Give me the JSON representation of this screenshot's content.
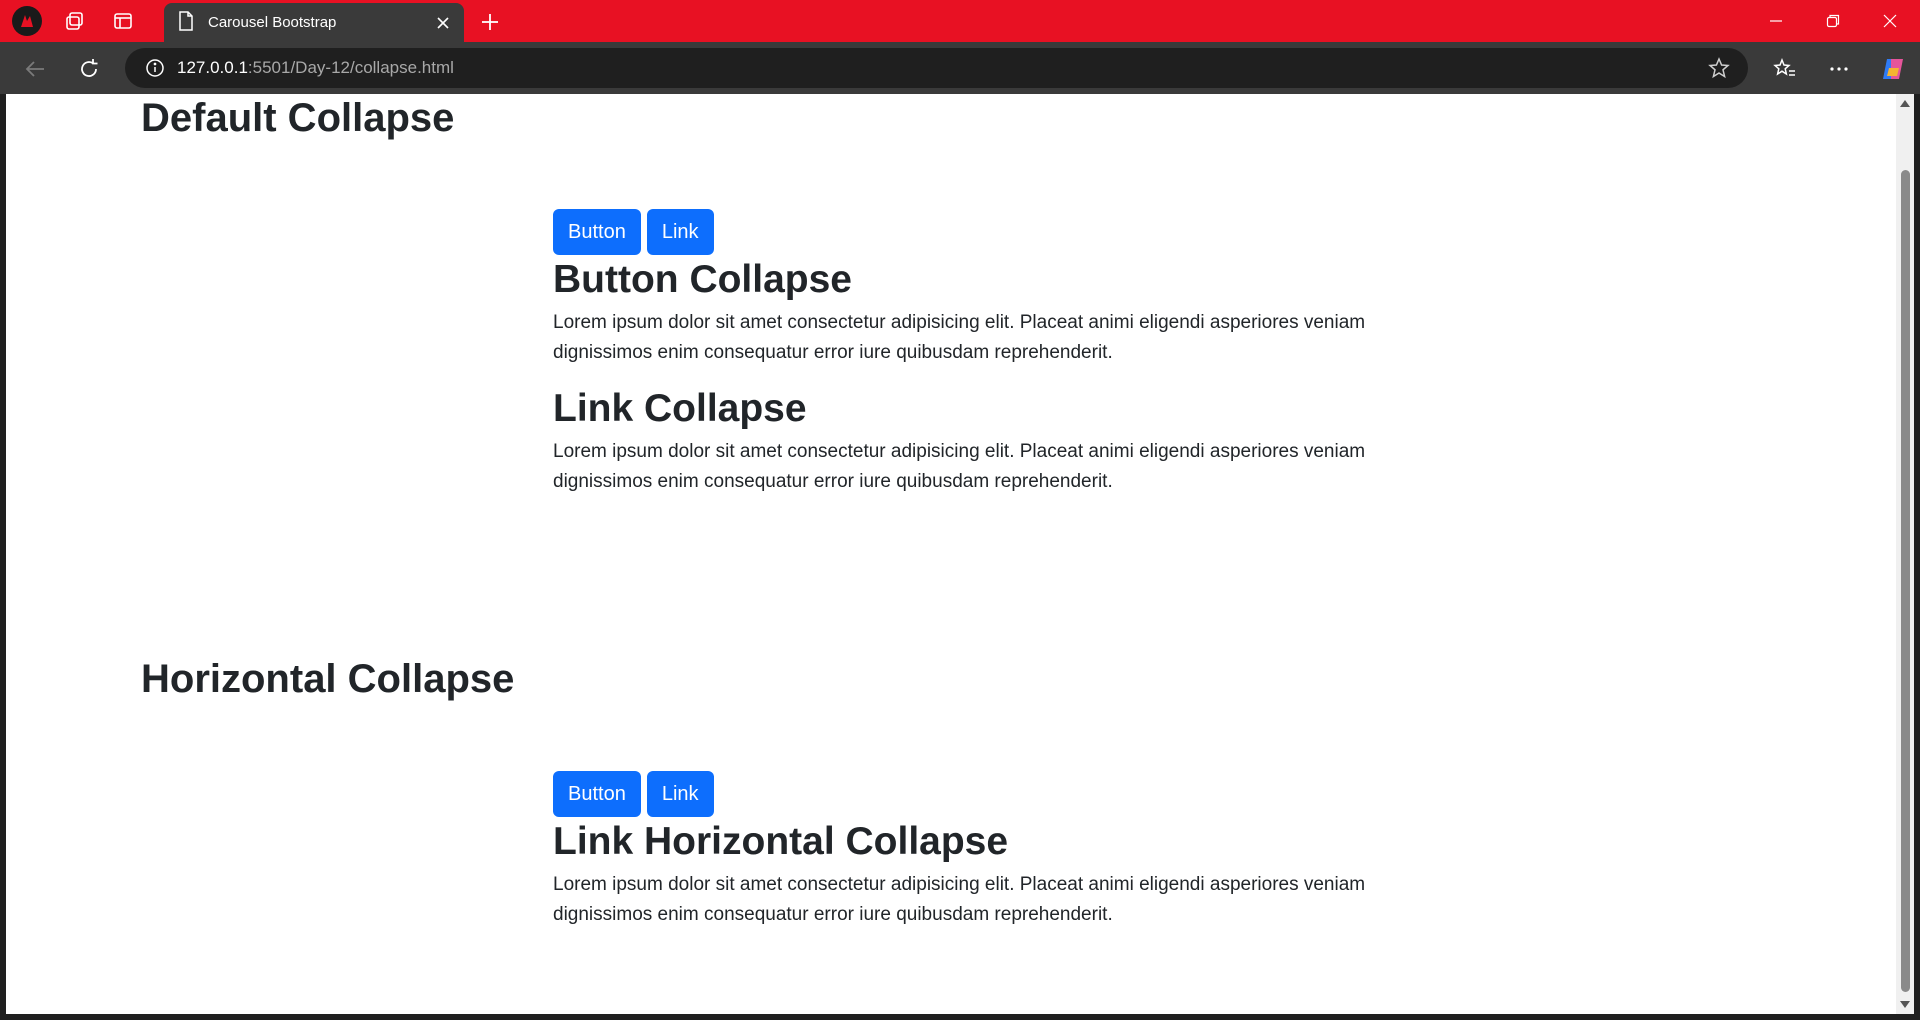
{
  "browser": {
    "tab_title": "Carousel Bootstrap",
    "url_host": "127.0.0.1",
    "url_rest": ":5501/Day-12/collapse.html"
  },
  "sections": [
    {
      "heading": "Default Collapse",
      "buttons": [
        "Button",
        "Link"
      ],
      "cards": [
        {
          "title": "Button Collapse",
          "text": "Lorem ipsum dolor sit amet consectetur adipisicing elit. Placeat animi eligendi asperiores veniam dignissimos enim consequatur error iure quibusdam reprehenderit."
        },
        {
          "title": "Link Collapse",
          "text": "Lorem ipsum dolor sit amet consectetur adipisicing elit. Placeat animi eligendi asperiores veniam dignissimos enim consequatur error iure quibusdam reprehenderit."
        }
      ]
    },
    {
      "heading": "Horizontal Collapse",
      "buttons": [
        "Button",
        "Link"
      ],
      "cards": [
        {
          "title": "Link Horizontal Collapse",
          "text": "Lorem ipsum dolor sit amet consectetur adipisicing elit. Placeat animi eligendi asperiores veniam dignissimos enim consequatur error iure quibusdam reprehenderit."
        }
      ]
    }
  ],
  "colors": {
    "titlebar": "#e81123",
    "primary_button": "#0d6efd",
    "text": "#212529"
  }
}
